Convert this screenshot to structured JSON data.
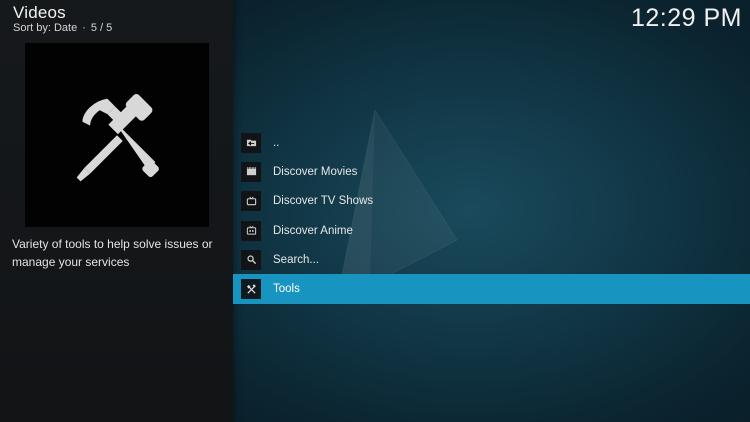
{
  "header": {
    "title": "Videos",
    "sort_label": "Sort by: Date",
    "separator": "·",
    "position": "5 / 5",
    "clock": "12:29 PM"
  },
  "info_panel": {
    "thumbnail_icon": "tools-icon",
    "description": "Variety of tools to help solve issues or manage your services"
  },
  "list": {
    "focused_index": 5,
    "items": [
      {
        "label": "..",
        "icon": "folder-back-icon"
      },
      {
        "label": "Discover Movies",
        "icon": "movie-icon"
      },
      {
        "label": "Discover TV Shows",
        "icon": "tv-icon"
      },
      {
        "label": "Discover Anime",
        "icon": "anime-icon"
      },
      {
        "label": "Search...",
        "icon": "search-icon"
      },
      {
        "label": "Tools",
        "icon": "tools-icon"
      }
    ]
  },
  "colors": {
    "focus_highlight": "#1794c0",
    "sidebar_bg": "#16191c",
    "background": "#113746"
  }
}
